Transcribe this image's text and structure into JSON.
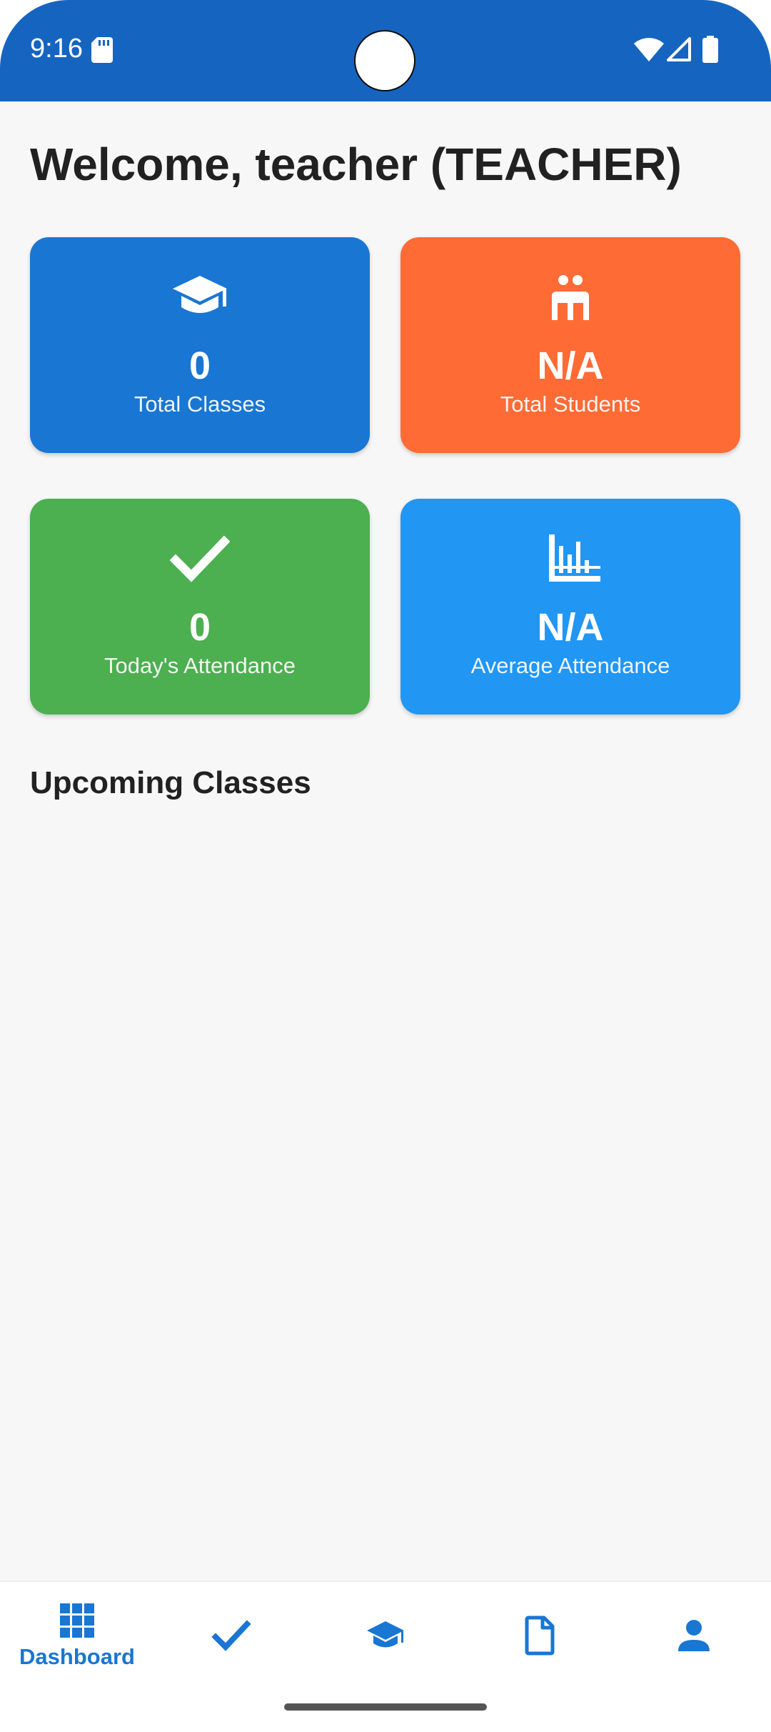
{
  "status_bar": {
    "time": "9:16",
    "background": "#1565C0",
    "icons": [
      "sd-card-icon",
      "wifi-icon",
      "signal-icon",
      "battery-icon"
    ]
  },
  "header": {
    "welcome": "Welcome, teacher (TEACHER)"
  },
  "stats": {
    "total_classes": {
      "value": "0",
      "label": "Total Classes",
      "icon": "graduation-cap-icon",
      "color": "#1976D2"
    },
    "total_students": {
      "value": "N/A",
      "label": "Total Students",
      "icon": "students-icon",
      "color": "#FF6B35"
    },
    "todays_attendance": {
      "value": "0",
      "label": "Today's Attendance",
      "icon": "checkmark-icon",
      "color": "#4CAF50"
    },
    "average_attendance": {
      "value": "N/A",
      "label": "Average Attendance",
      "icon": "bar-chart-icon",
      "color": "#2196F3"
    }
  },
  "upcoming": {
    "title": "Upcoming Classes"
  },
  "bottom_nav": {
    "accent": "#1976D2",
    "items": [
      {
        "id": "dashboard",
        "label": "Dashboard",
        "icon": "dashboard-grid-icon",
        "active": true
      },
      {
        "id": "attendance",
        "label": "",
        "icon": "checkmark-icon",
        "active": false
      },
      {
        "id": "classes",
        "label": "",
        "icon": "graduation-cap-icon",
        "active": false
      },
      {
        "id": "reports",
        "label": "",
        "icon": "document-icon",
        "active": false
      },
      {
        "id": "profile",
        "label": "",
        "icon": "person-icon",
        "active": false
      }
    ]
  }
}
